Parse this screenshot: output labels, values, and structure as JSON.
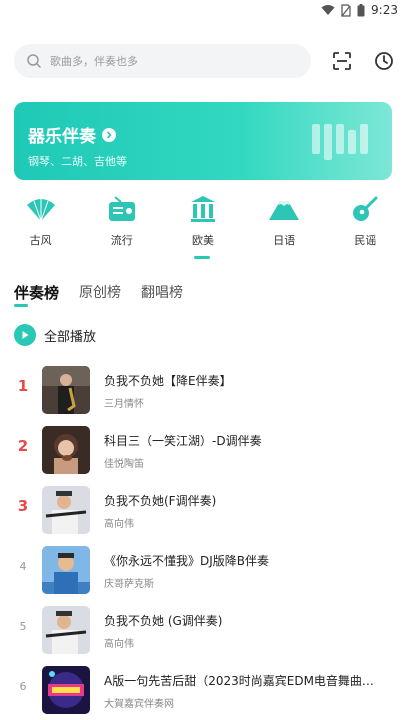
{
  "status_bar": {
    "time": "9:23"
  },
  "search": {
    "placeholder": "歌曲多，伴奏也多"
  },
  "banner": {
    "title": "器乐伴奏",
    "subtitle": "钢琴、二胡、吉他等"
  },
  "categories": [
    {
      "label": "古风",
      "icon": "folding-fan-icon"
    },
    {
      "label": "流行",
      "icon": "radio-icon"
    },
    {
      "label": "欧美",
      "icon": "columns-icon"
    },
    {
      "label": "日语",
      "icon": "mount-fuji-icon"
    },
    {
      "label": "民谣",
      "icon": "guitar-icon"
    }
  ],
  "tabs": [
    {
      "label": "伴奏榜",
      "active": true
    },
    {
      "label": "原创榜",
      "active": false
    },
    {
      "label": "翻唱榜",
      "active": false
    }
  ],
  "play_all_label": "全部播放",
  "songs": [
    {
      "rank": "1",
      "title": "负我不负她【降E伴奏】",
      "artist": "三月情怀"
    },
    {
      "rank": "2",
      "title": "科目三（一笑江湖）-D调伴奏",
      "artist": "佳悦陶笛"
    },
    {
      "rank": "3",
      "title": "负我不负她(F调伴奏)",
      "artist": "高向伟"
    },
    {
      "rank": "4",
      "title": "《你永远不懂我》DJ版降B伴奏",
      "artist": "庆哥萨克斯"
    },
    {
      "rank": "5",
      "title": "负我不负她 (G调伴奏)",
      "artist": "高向伟"
    },
    {
      "rank": "6",
      "title": "A版一句先苦后甜（2023时尚嘉宾EDM电音舞曲…",
      "artist": "大賀嘉宾伴奏网"
    }
  ],
  "colors": {
    "accent": "#28c8b4",
    "rank_top": "#e84a4a"
  }
}
